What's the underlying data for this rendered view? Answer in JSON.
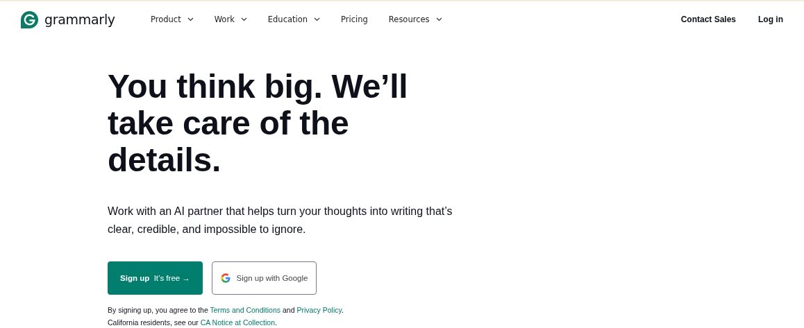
{
  "brand": {
    "name": "grammarly"
  },
  "nav": [
    {
      "label": "Product",
      "has_menu": true
    },
    {
      "label": "Work",
      "has_menu": true
    },
    {
      "label": "Education",
      "has_menu": true
    },
    {
      "label": "Pricing",
      "has_menu": false
    },
    {
      "label": "Resources",
      "has_menu": true
    }
  ],
  "header_actions": [
    {
      "label": "Contact Sales"
    },
    {
      "label": "Log in"
    }
  ],
  "hero": {
    "title": "You think big. We’ll take care of the details.",
    "subtitle": "Work with an AI partner that helps turn your thoughts into writing that’s clear, credible, and impossible to ignore.",
    "primary_button": {
      "label": "Sign up",
      "note": "It’s free",
      "arrow": "→"
    },
    "google_button": {
      "label": "Sign up with Google"
    },
    "legal": [
      [
        {
          "text": "By signing up, you agree to the ",
          "kind": "text"
        },
        {
          "text": "Terms and Conditions",
          "kind": "link"
        },
        {
          "text": " and ",
          "kind": "text"
        },
        {
          "text": "Privacy Policy",
          "kind": "link"
        },
        {
          "text": ".",
          "kind": "text"
        }
      ],
      [
        {
          "text": "California residents, see our ",
          "kind": "text"
        },
        {
          "text": "CA Notice at Collection",
          "kind": "link"
        },
        {
          "text": ".",
          "kind": "text"
        }
      ]
    ]
  }
}
